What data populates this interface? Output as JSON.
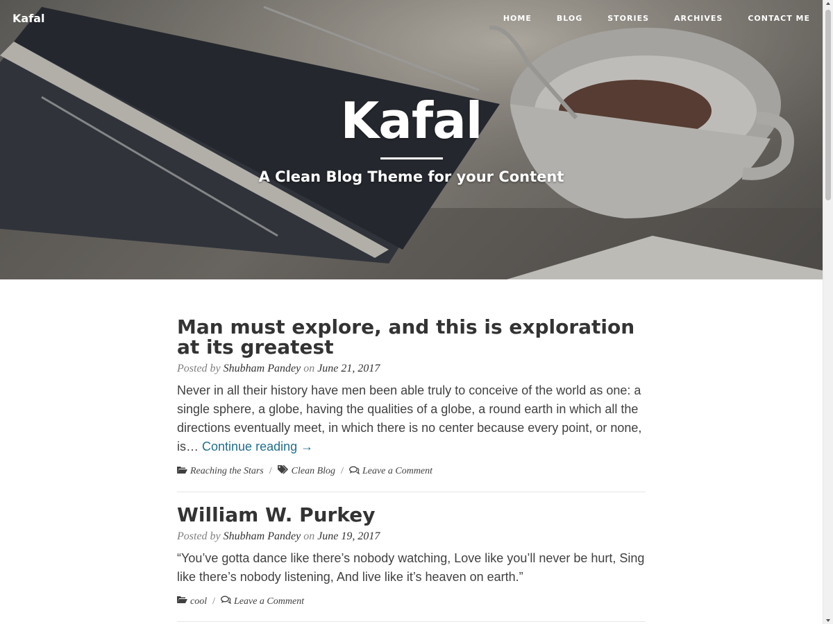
{
  "brand": "Kafal",
  "nav": [
    "HOME",
    "BLOG",
    "STORIES",
    "ARCHIVES",
    "CONTACT ME"
  ],
  "hero": {
    "title": "Kafal",
    "subtitle": "A Clean Blog Theme for your Content"
  },
  "posts": [
    {
      "title": "Man must explore, and this is exploration at its greatest",
      "posted_by": "Posted by",
      "author": "Shubham Pandey",
      "on": "on",
      "date": "June 21, 2017",
      "excerpt": "Never in all their history have men been able truly to conceive of the world as one: a single sphere, a globe, having the qualities of a globe, a round earth in which all the directions eventually meet, in which there is no center because every point, or none, is…",
      "continue": "Continue reading →",
      "category": "Reaching the Stars",
      "tag": "Clean Blog",
      "comment": "Leave a Comment"
    },
    {
      "title": "William W. Purkey",
      "posted_by": "Posted by",
      "author": "Shubham Pandey",
      "on": "on",
      "date": "June 19, 2017",
      "excerpt": "“You’ve gotta dance like there’s nobody watching, Love like you’ll never be hurt, Sing like there’s nobody listening, And live like it’s heaven on earth.”",
      "category": "cool",
      "comment": "Leave a Comment"
    }
  ],
  "icons": {
    "category": "folder-open-icon",
    "tag": "tags-icon",
    "comment": "comments-icon"
  }
}
